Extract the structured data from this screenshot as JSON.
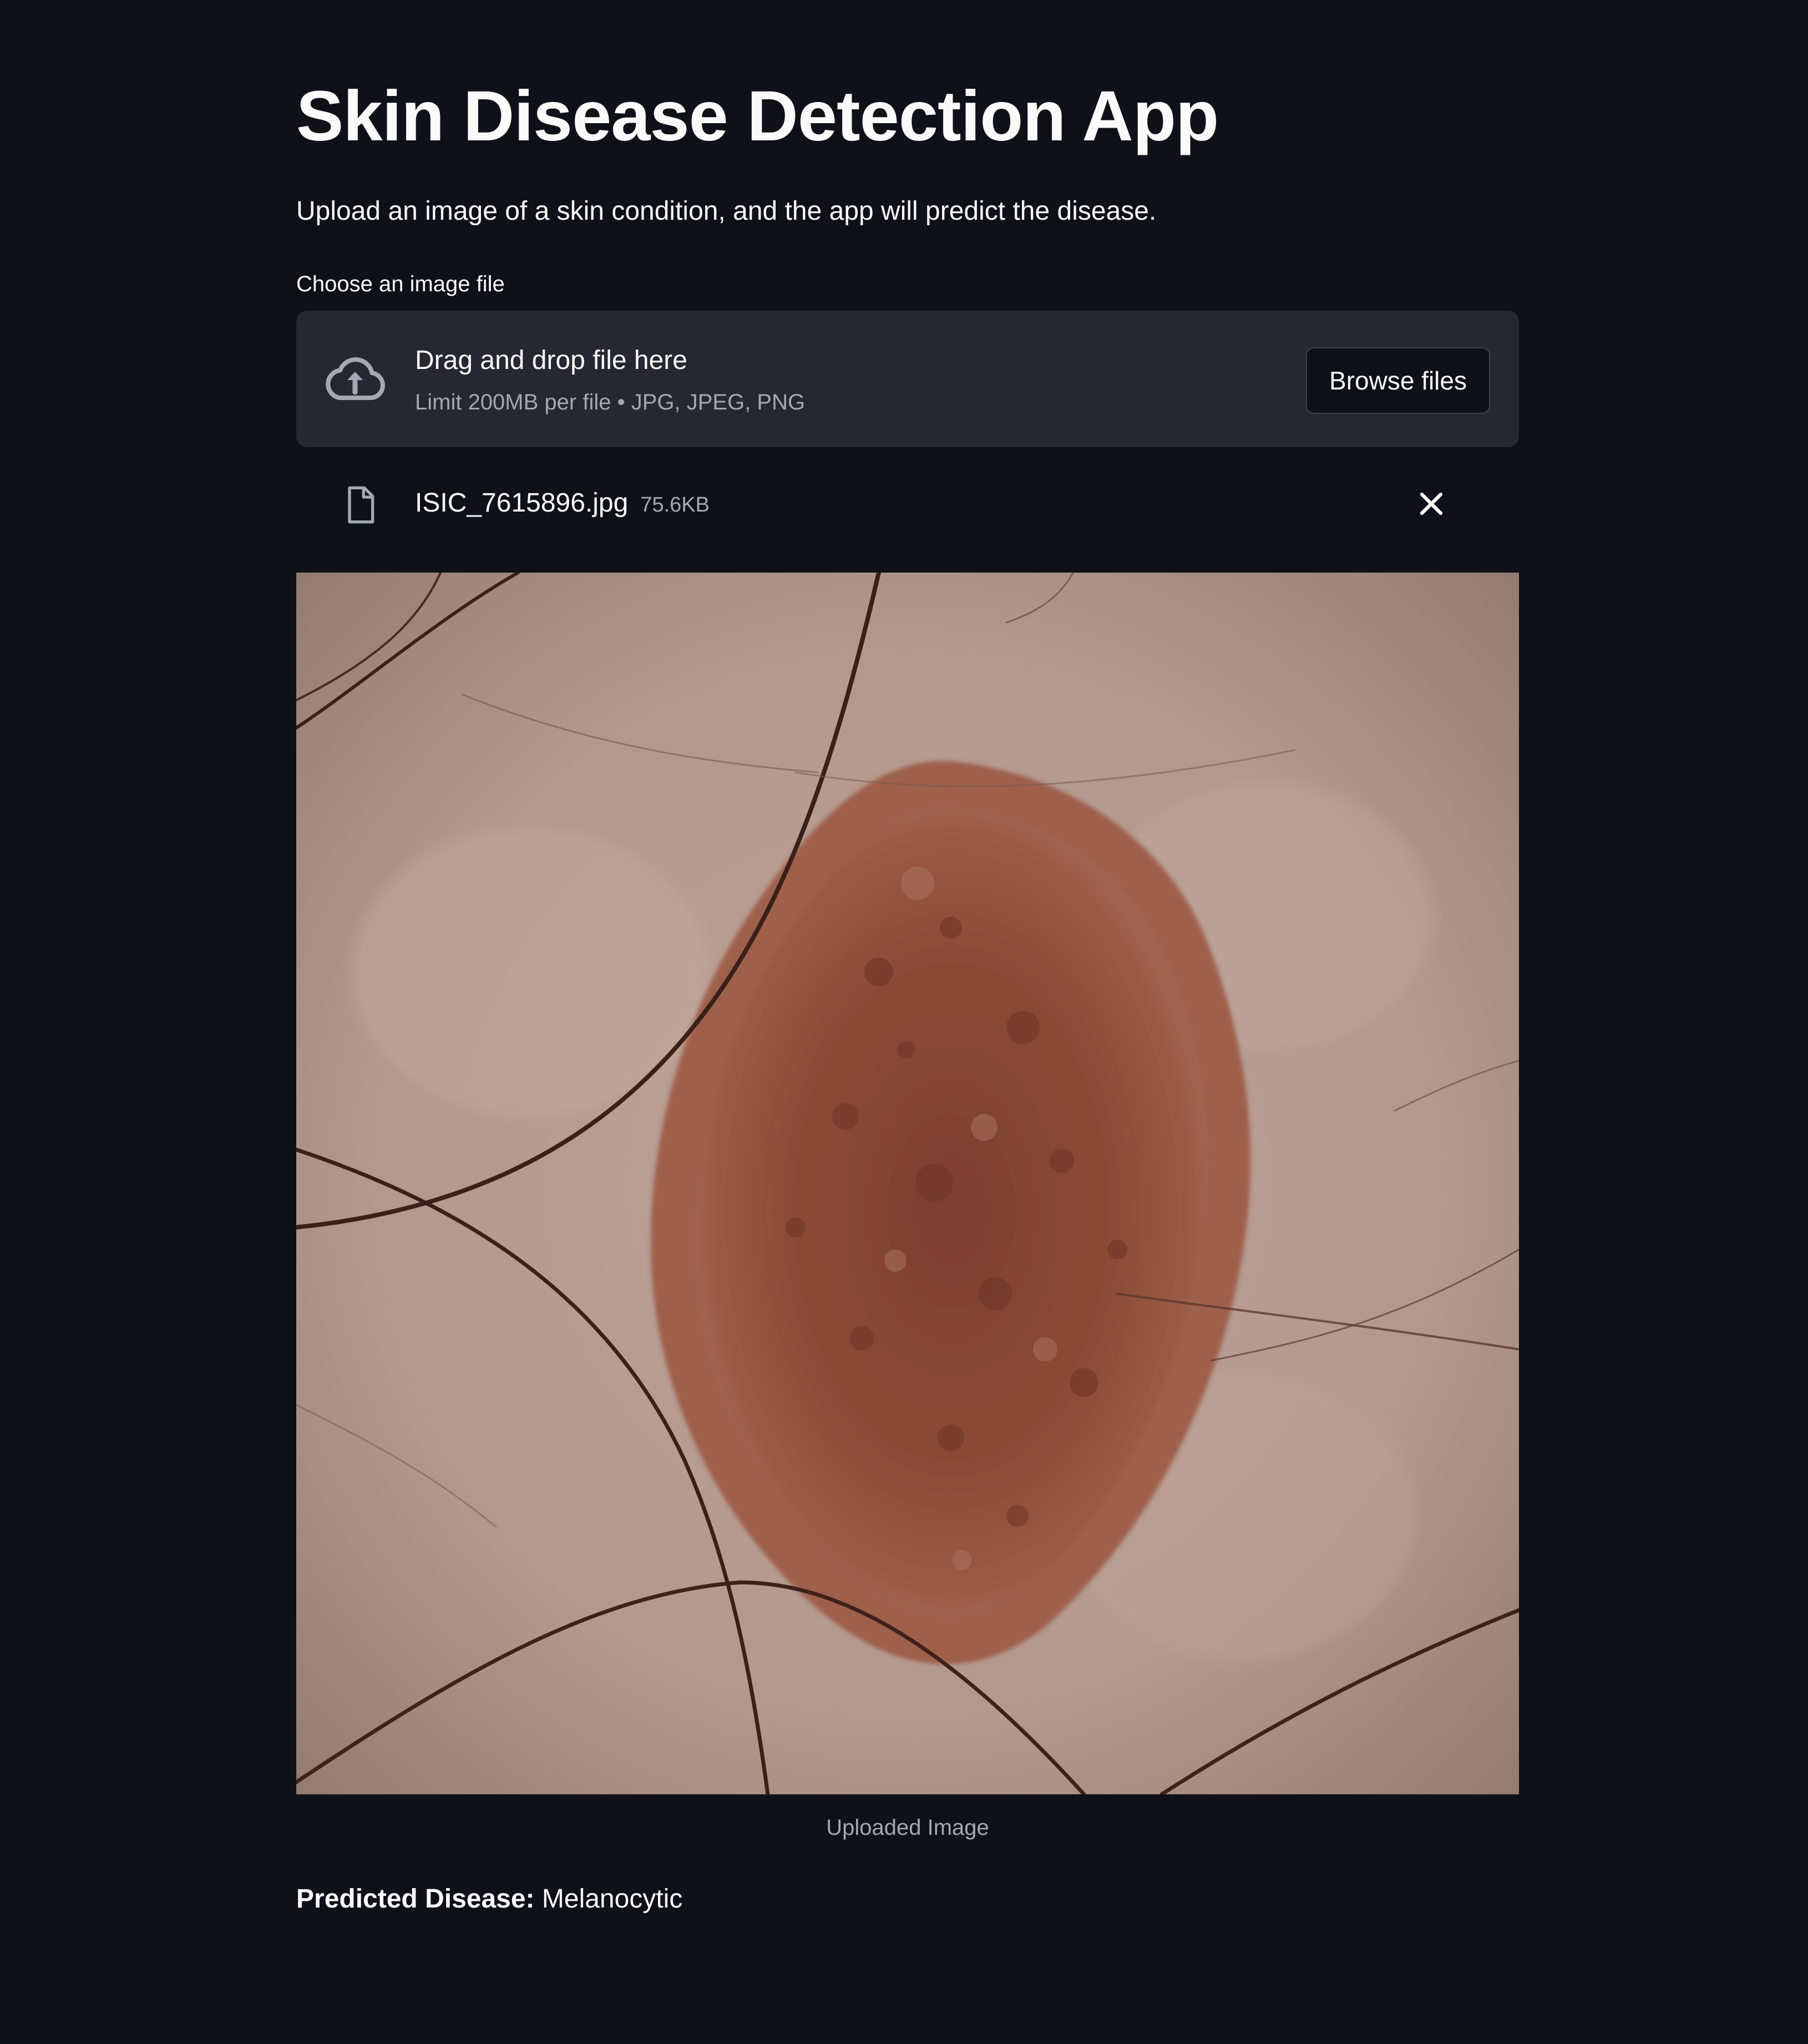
{
  "app": {
    "title": "Skin Disease Detection App",
    "subtitle": "Upload an image of a skin condition, and the app will predict the disease."
  },
  "uploader": {
    "label": "Choose an image file",
    "dropzone_text": "Drag and drop file here",
    "limit_text": "Limit 200MB per file • JPG, JPEG, PNG",
    "browse_label": "Browse files",
    "upload_icon": "cloud-upload-icon"
  },
  "uploaded_file": {
    "name": "ISIC_7615896.jpg",
    "size": "75.6KB",
    "file_icon": "file-icon",
    "remove_icon": "close-icon"
  },
  "image": {
    "caption": "Uploaded Image"
  },
  "prediction": {
    "label": "Predicted Disease:",
    "value": "Melanocytic"
  },
  "colors": {
    "background": "#0e1117",
    "surface": "#262730",
    "text": "#fafafa",
    "muted_text": "#a3a8b4",
    "skin": "#b49a90",
    "lesion": "#8a4a36"
  }
}
